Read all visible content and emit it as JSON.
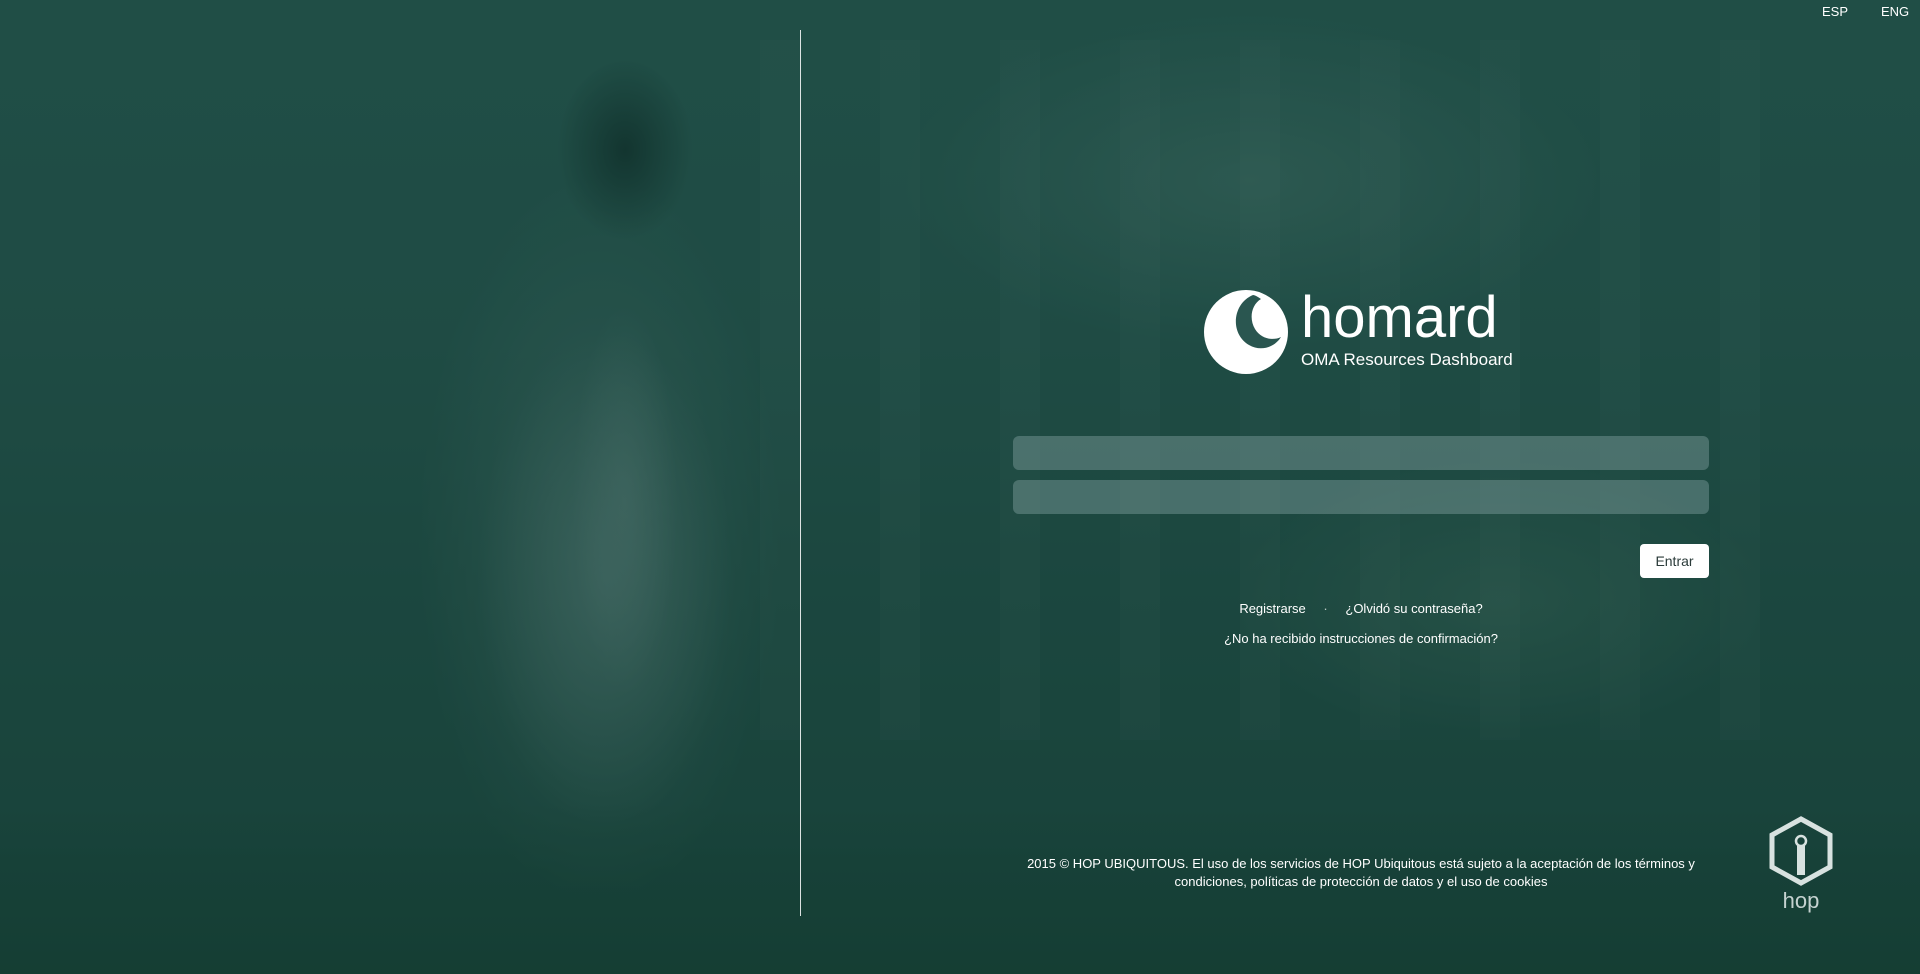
{
  "language_switch": {
    "esp_label": "ESP",
    "eng_label": "ENG"
  },
  "brand": {
    "name": "homard",
    "subtitle": "OMA Resources Dashboard",
    "logo_icon": "homard-logo-icon"
  },
  "login_form": {
    "username_value": "",
    "password_value": "",
    "submit_label": "Entrar"
  },
  "links": {
    "register": "Registrarse",
    "separator": "·",
    "forgot_password": "¿Olvidó su contraseña?",
    "confirmation": "¿No ha recibido instrucciones de confirmación?"
  },
  "footer": {
    "line1": "2015 © HOP UBIQUITOUS. El uso de los servicios de HOP Ubiquitous está sujeto a la aceptación de los términos y",
    "line2": "condiciones, políticas de protección de datos y el uso de cookies"
  },
  "company_logo": {
    "text": "hop",
    "icon": "hop-ubiquitous-logo-icon"
  },
  "colors": {
    "overlay": "#124038",
    "field_background": "#8caaaa",
    "button_background": "#ffffff",
    "text": "#ffffff"
  }
}
